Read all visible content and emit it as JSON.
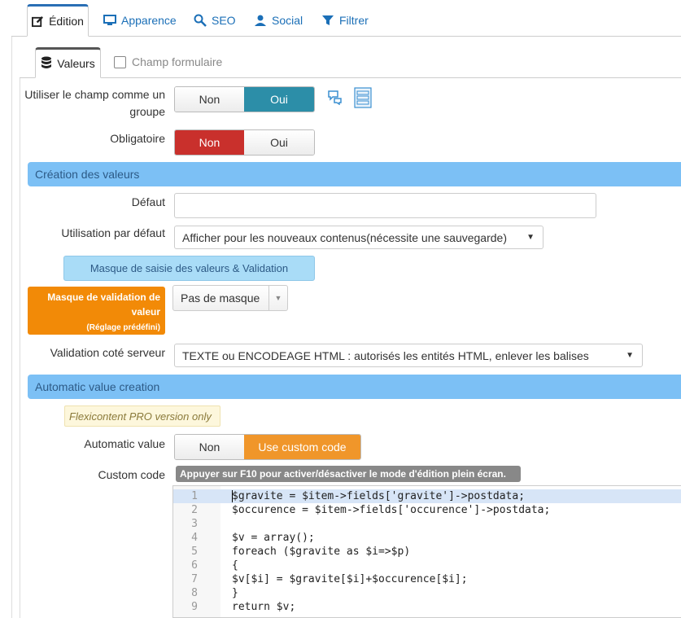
{
  "top_tabs": [
    {
      "label": "Édition",
      "icon": "edit-icon"
    },
    {
      "label": "Apparence",
      "icon": "monitor-icon"
    },
    {
      "label": "SEO",
      "icon": "search-icon"
    },
    {
      "label": "Social",
      "icon": "user-icon"
    },
    {
      "label": "Filtrer",
      "icon": "filter-icon"
    }
  ],
  "sub_tabs": {
    "values": {
      "label": "Valeurs",
      "icon": "database-icon"
    },
    "form_field": {
      "label": "Champ formulaire"
    }
  },
  "group_field": {
    "label": "Utiliser le champ comme un groupe",
    "options": [
      "Non",
      "Oui"
    ],
    "selected": "Oui"
  },
  "required": {
    "label": "Obligatoire",
    "options": [
      "Non",
      "Oui"
    ],
    "selected": "Non"
  },
  "section_values": "Création des valeurs",
  "default": {
    "label": "Défaut",
    "value": ""
  },
  "default_usage": {
    "label": "Utilisation par défaut",
    "value": "Afficher pour les nouveaux contenus(nécessite une sauvegarde)"
  },
  "mask_button": "Masque de saisie des valeurs & Validation",
  "validation_mask": {
    "label": "Masque de validation de valeur",
    "sublabel": "(Réglage prédéfini)",
    "value": "Pas de masque"
  },
  "server_validation": {
    "label": "Validation coté serveur",
    "value": "TEXTE ou ENCODEAGE HTML : autorisés les entités HTML, enlever les balises"
  },
  "section_auto": "Automatic value creation",
  "pro_note": "Flexicontent PRO version only",
  "auto_value": {
    "label": "Automatic value",
    "options": [
      "Non",
      "Use custom code"
    ],
    "selected": "Use custom code"
  },
  "custom_code": {
    "label": "Custom code",
    "hint": "Appuyer sur F10 pour activer/désactiver le mode d'édition plein écran.",
    "lines": [
      {
        "n": "1",
        "text": "$gravite = $item->fields['gravite']->postdata;"
      },
      {
        "n": "2",
        "text": "$occurence = $item->fields['occurence']->postdata;"
      },
      {
        "n": "3",
        "text": ""
      },
      {
        "n": "4",
        "text": "$v = array();"
      },
      {
        "n": "5",
        "text": "foreach ($gravite as $i=>$p)"
      },
      {
        "n": "6",
        "text": "{"
      },
      {
        "n": "7",
        "text": "$v[$i] = $gravite[$i]+$occurence[$i];"
      },
      {
        "n": "8",
        "text": "}"
      },
      {
        "n": "9",
        "text": "return $v;"
      }
    ]
  },
  "colors": {
    "accent_blue": "#2c8ea8",
    "section_blue": "#7cc0f5",
    "danger_red": "#c9302c",
    "orange": "#f0962a"
  }
}
